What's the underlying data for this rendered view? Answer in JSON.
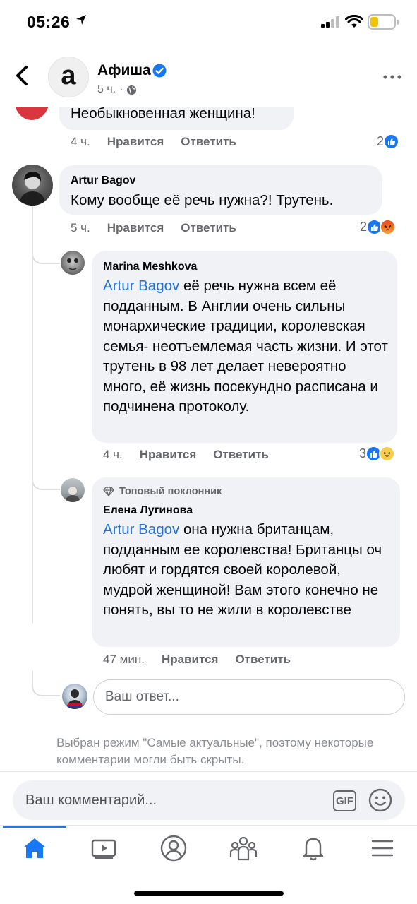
{
  "status_bar": {
    "time": "05:26"
  },
  "header": {
    "page_name": "Афиша",
    "page_avatar_letter": "a",
    "time_ago": "5 ч.",
    "dot": "·"
  },
  "comments": [
    {
      "author": "",
      "text": "Необыкновенная женщина!",
      "time": "4 ч.",
      "like_label": "Нравится",
      "reply_label": "Ответить",
      "reaction_count": "2",
      "reactions": [
        "like"
      ]
    },
    {
      "author": "Artur Bagov",
      "text": "Кому вообще её речь нужна?! Трутень.",
      "time": "5 ч.",
      "like_label": "Нравится",
      "reply_label": "Ответить",
      "reaction_count": "2",
      "reactions": [
        "like",
        "angry"
      ]
    },
    {
      "author": "Marina Meshkova",
      "mention": "Artur Bagov",
      "text": " её речь нужна всем её подданным.  В Англии очень сильны монархические традиции, королевская семья- неотъемлемая часть жизни. И этот трутень в 98 лет делает невероятно много, её жизнь посекундно расписана и подчинена протоколу.",
      "time": "4 ч.",
      "like_label": "Нравится",
      "reply_label": "Ответить",
      "reaction_count": "3",
      "reactions": [
        "like",
        "haha"
      ]
    },
    {
      "badge": "Топовый поклонник",
      "author": "Елена Лугинова",
      "mention": "Artur Bagov",
      "text": " она нужна британцам, подданным ее королевства! Британцы оч любят и гордятся своей королевой, мудрой женщиной! Вам этого конечно не понять, вы то не жили в королевстве",
      "time": "47 мин.",
      "like_label": "Нравится",
      "reply_label": "Ответить"
    }
  ],
  "reply_box": {
    "placeholder": "Ваш ответ..."
  },
  "notice": "Выбран режим \"Самые актуальные\", поэтому некоторые комментарии могли быть скрыты.",
  "composer": {
    "placeholder": "Ваш комментарий...",
    "gif_label": "GIF"
  },
  "tabbar": {
    "items": [
      "home-icon",
      "video-icon",
      "profile-icon",
      "groups-icon",
      "notifications-icon",
      "menu-icon"
    ],
    "accent": "#1877f2"
  },
  "colors": {
    "accent": "#1877f2",
    "mention": "#216fdb",
    "bubble": "#f0f2f5",
    "secondary_text": "#65676b"
  }
}
